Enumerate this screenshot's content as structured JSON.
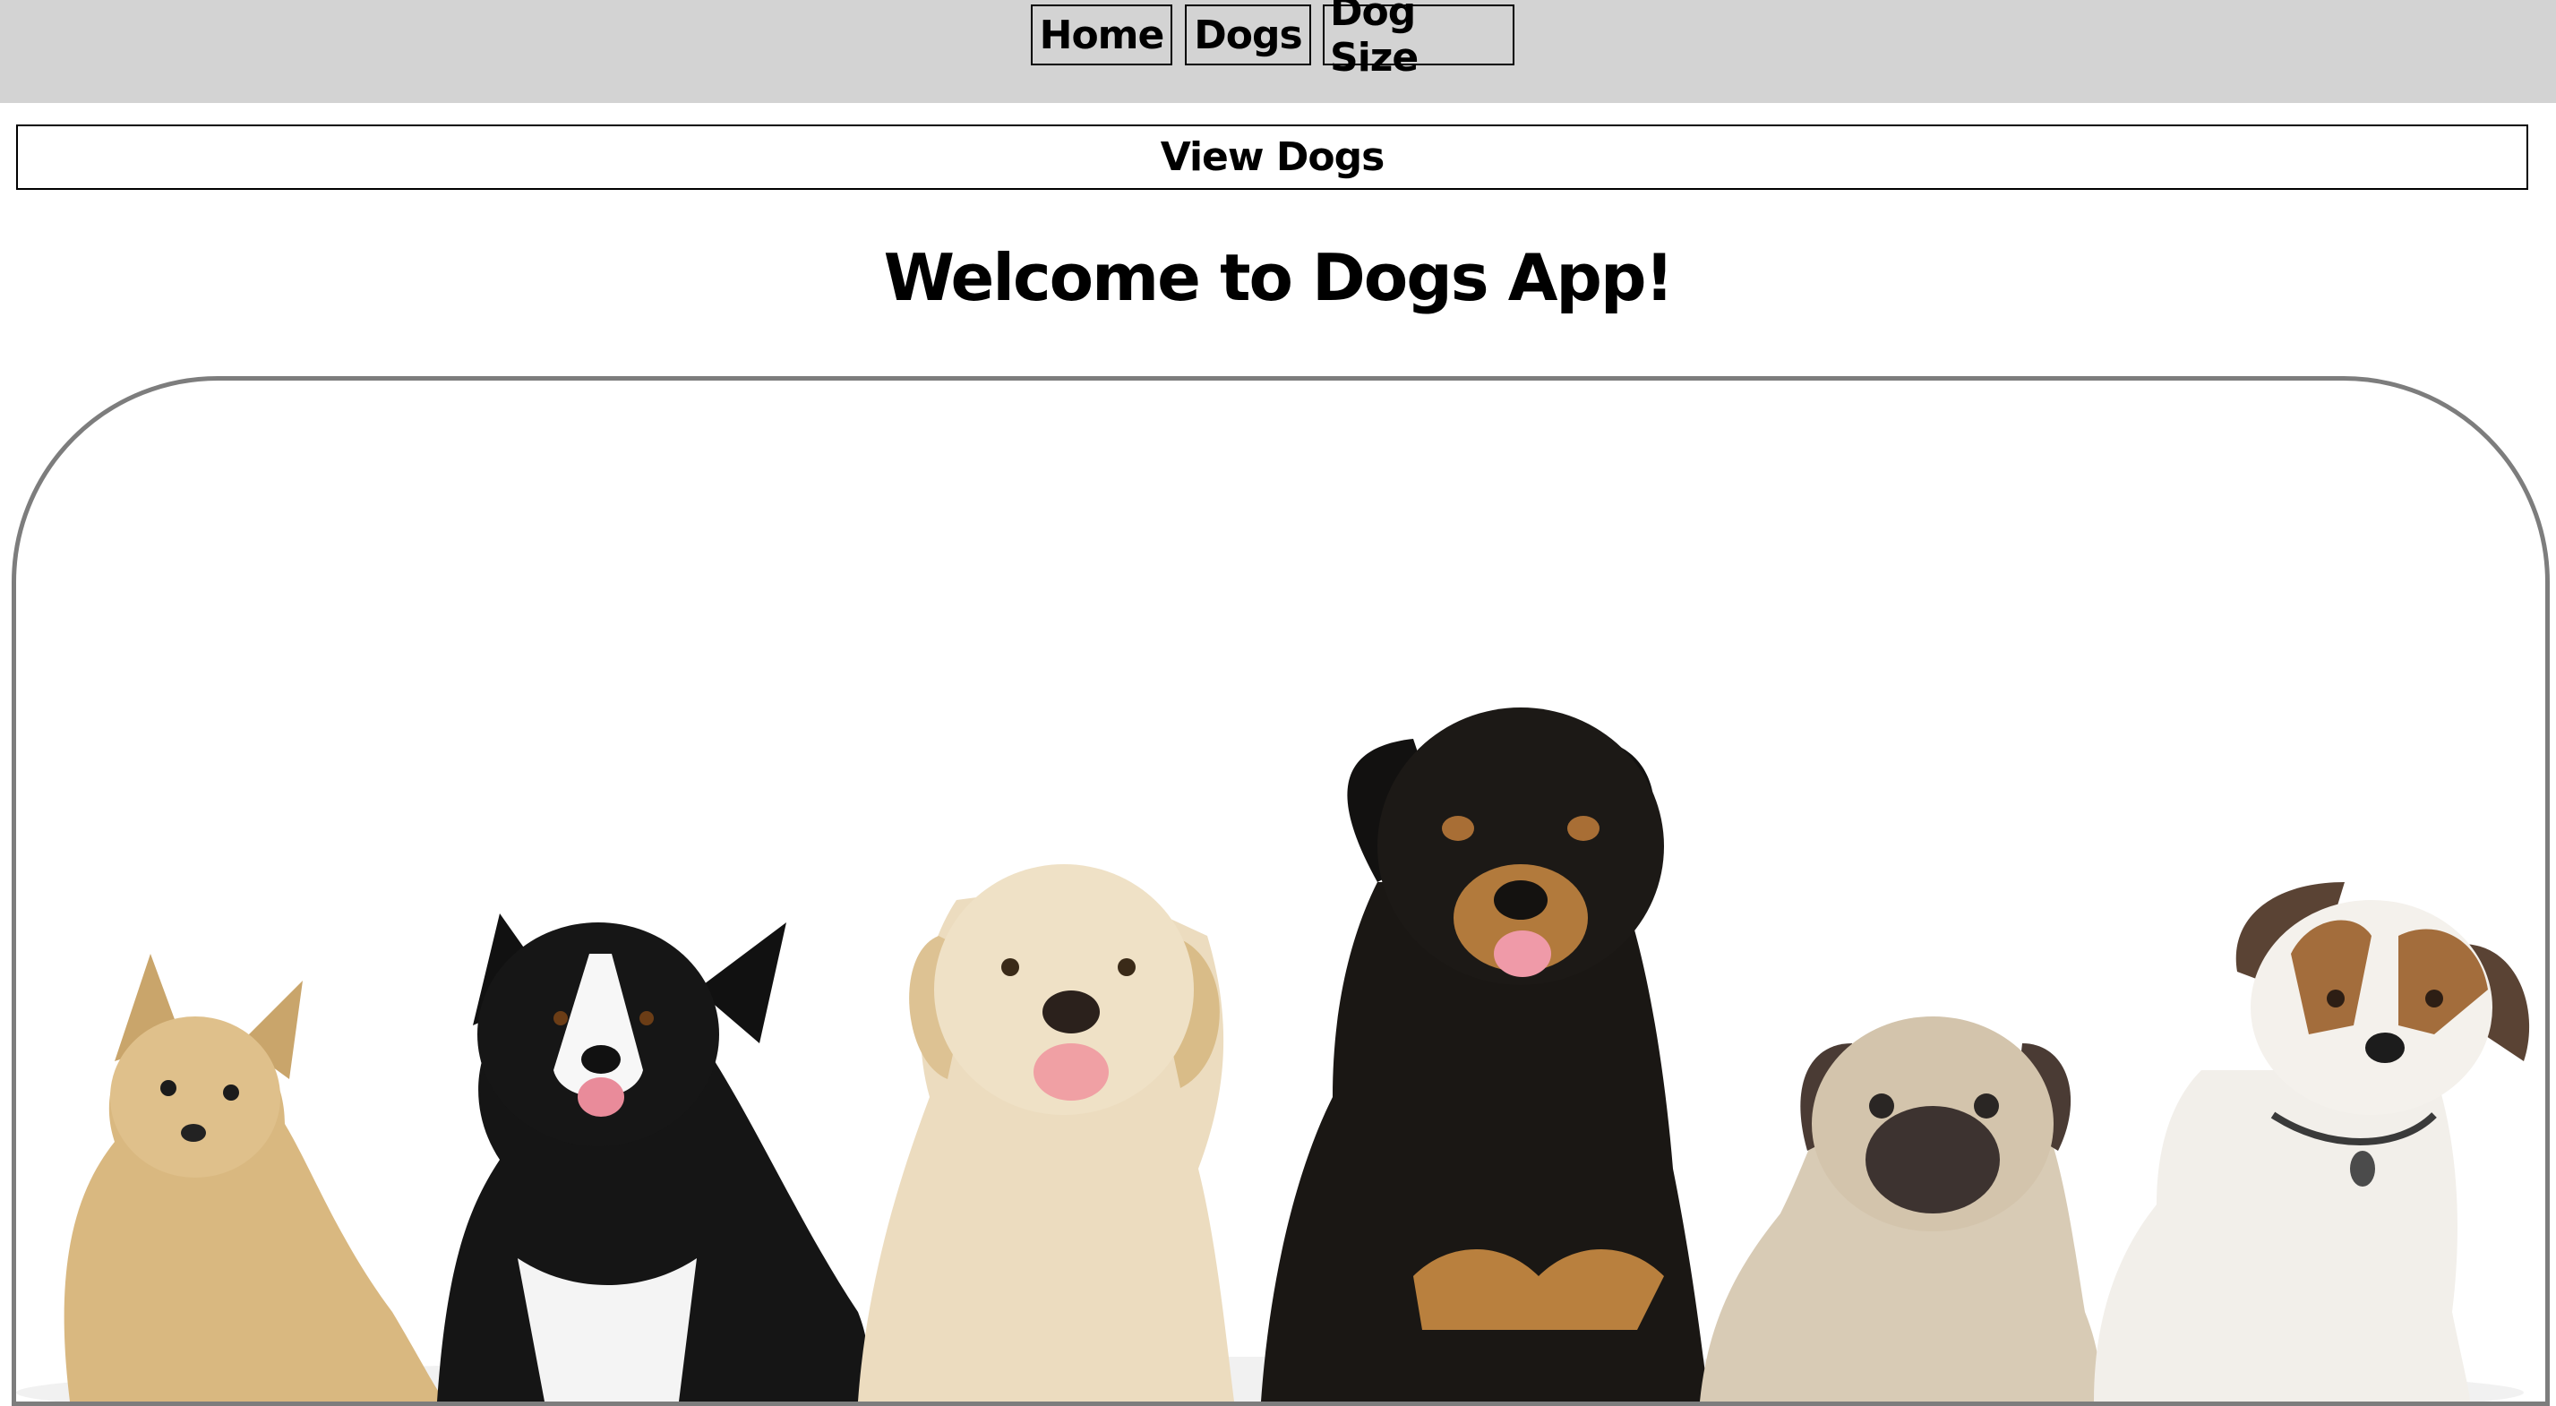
{
  "nav": {
    "home_label": "Home",
    "dogs_label": "Dogs",
    "dog_size_label": "Dog Size"
  },
  "view_dogs_label": "View Dogs",
  "title": "Welcome to Dogs App!",
  "hero_image": {
    "dogs": [
      {
        "name": "yorkshire-terrier",
        "coat": "#d9b880"
      },
      {
        "name": "border-collie",
        "coat": "#151515"
      },
      {
        "name": "golden-retriever",
        "coat": "#ecdcbf"
      },
      {
        "name": "rottweiler",
        "coat": "#1a1714"
      },
      {
        "name": "pug",
        "coat": "#d8cbb5"
      },
      {
        "name": "jack-russell-terrier",
        "coat": "#f2efea"
      }
    ]
  },
  "colors": {
    "navbar_bg": "#d3d3d3",
    "hero_border": "#7d7d7d"
  }
}
